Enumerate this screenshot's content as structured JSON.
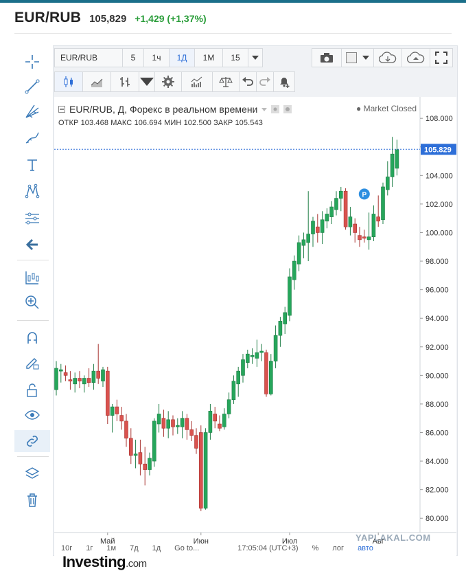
{
  "header": {
    "symbol": "EUR/RUB",
    "price": "105,829",
    "change": "+1,429 (+1,37%)"
  },
  "toolbar": {
    "symbol_input": "EUR/RUB",
    "intervals": [
      "5",
      "1ч",
      "1Д",
      "1М",
      "15"
    ],
    "selected_interval": "1Д"
  },
  "chart_header": {
    "title": "EUR/RUB, Д, Форекс в реальном времени",
    "status": "● Market Closed",
    "ohlc": "ОТКР 103.468  МАКС 106.694  МИН 102.500  ЗАКР 105.543"
  },
  "bottom": {
    "ranges": [
      "10г",
      "1г",
      "1м",
      "7д",
      "1д"
    ],
    "goto": "Go to...",
    "time": "17:05:04 (UTC+3)",
    "pct": "%",
    "log": "лог",
    "auto": "авто"
  },
  "watermark": "YAPLAKAL.COM",
  "logo": {
    "main": "Investing",
    "suffix": ".com"
  },
  "colors": {
    "up": "#26a65b",
    "down": "#d9534f",
    "last_price": "#2e6fd8",
    "marker": "#2e8fe0"
  },
  "chart_data": {
    "type": "candlestick",
    "title": "EUR/RUB, Д, Форекс в реальном времени",
    "ylim": [
      79.0,
      109.5
    ],
    "y_ticks": [
      80.0,
      82.0,
      84.0,
      86.0,
      88.0,
      90.0,
      92.0,
      94.0,
      96.0,
      98.0,
      100.0,
      102.0,
      104.0,
      106.0,
      108.0
    ],
    "x_labels": [
      "Май",
      "Июн",
      "Июл",
      "Авг"
    ],
    "x_label_index": [
      11,
      31,
      50,
      69
    ],
    "last_price": 105.829,
    "last_price_label": "105.829",
    "marker_label": "P",
    "marker": {
      "index": 66,
      "value": 102.7
    },
    "candles": [
      {
        "o": 89.0,
        "h": 91.0,
        "l": 88.6,
        "c": 90.5
      },
      {
        "o": 90.3,
        "h": 90.8,
        "l": 89.5,
        "c": 90.4
      },
      {
        "o": 90.2,
        "h": 90.7,
        "l": 89.6,
        "c": 90.0
      },
      {
        "o": 89.7,
        "h": 90.3,
        "l": 89.0,
        "c": 89.6
      },
      {
        "o": 89.4,
        "h": 90.2,
        "l": 88.8,
        "c": 89.8
      },
      {
        "o": 89.8,
        "h": 90.3,
        "l": 89.1,
        "c": 89.6
      },
      {
        "o": 89.4,
        "h": 90.0,
        "l": 88.8,
        "c": 89.8
      },
      {
        "o": 89.8,
        "h": 90.5,
        "l": 89.2,
        "c": 89.5
      },
      {
        "o": 89.5,
        "h": 90.8,
        "l": 89.0,
        "c": 90.3
      },
      {
        "o": 90.3,
        "h": 92.2,
        "l": 89.4,
        "c": 89.8
      },
      {
        "o": 89.6,
        "h": 90.6,
        "l": 89.2,
        "c": 90.4
      },
      {
        "o": 90.3,
        "h": 90.6,
        "l": 86.6,
        "c": 87.2
      },
      {
        "o": 87.2,
        "h": 88.0,
        "l": 86.0,
        "c": 87.8
      },
      {
        "o": 87.8,
        "h": 88.3,
        "l": 86.8,
        "c": 87.3
      },
      {
        "o": 87.2,
        "h": 87.8,
        "l": 86.2,
        "c": 86.8
      },
      {
        "o": 86.8,
        "h": 87.3,
        "l": 85.0,
        "c": 85.6
      },
      {
        "o": 85.6,
        "h": 86.3,
        "l": 83.8,
        "c": 84.4
      },
      {
        "o": 84.4,
        "h": 85.5,
        "l": 83.5,
        "c": 84.5
      },
      {
        "o": 84.6,
        "h": 85.5,
        "l": 83.0,
        "c": 83.8
      },
      {
        "o": 83.8,
        "h": 85.0,
        "l": 82.3,
        "c": 83.4
      },
      {
        "o": 83.4,
        "h": 84.6,
        "l": 83.0,
        "c": 84.2
      },
      {
        "o": 84.0,
        "h": 87.0,
        "l": 83.6,
        "c": 86.8
      },
      {
        "o": 86.6,
        "h": 88.0,
        "l": 86.0,
        "c": 87.3
      },
      {
        "o": 87.0,
        "h": 87.6,
        "l": 85.7,
        "c": 86.3
      },
      {
        "o": 86.3,
        "h": 87.5,
        "l": 85.6,
        "c": 86.9
      },
      {
        "o": 86.9,
        "h": 87.2,
        "l": 85.8,
        "c": 86.4
      },
      {
        "o": 86.4,
        "h": 87.0,
        "l": 85.9,
        "c": 86.5
      },
      {
        "o": 86.4,
        "h": 87.5,
        "l": 85.6,
        "c": 87.0
      },
      {
        "o": 87.0,
        "h": 87.3,
        "l": 85.5,
        "c": 86.2
      },
      {
        "o": 86.2,
        "h": 86.8,
        "l": 85.4,
        "c": 85.8
      },
      {
        "o": 85.8,
        "h": 86.3,
        "l": 84.5,
        "c": 84.9
      },
      {
        "o": 86.0,
        "h": 86.5,
        "l": 80.5,
        "c": 80.7
      },
      {
        "o": 80.7,
        "h": 86.3,
        "l": 80.6,
        "c": 86.0
      },
      {
        "o": 86.0,
        "h": 88.0,
        "l": 85.5,
        "c": 87.5
      },
      {
        "o": 87.3,
        "h": 87.8,
        "l": 86.3,
        "c": 86.8
      },
      {
        "o": 86.6,
        "h": 87.2,
        "l": 86.1,
        "c": 86.3
      },
      {
        "o": 86.4,
        "h": 87.7,
        "l": 86.2,
        "c": 87.3
      },
      {
        "o": 87.3,
        "h": 88.8,
        "l": 87.0,
        "c": 88.3
      },
      {
        "o": 88.3,
        "h": 90.0,
        "l": 88.0,
        "c": 89.6
      },
      {
        "o": 89.4,
        "h": 90.6,
        "l": 88.5,
        "c": 90.3
      },
      {
        "o": 90.0,
        "h": 91.5,
        "l": 89.5,
        "c": 91.1
      },
      {
        "o": 90.9,
        "h": 91.8,
        "l": 90.5,
        "c": 91.5
      },
      {
        "o": 91.3,
        "h": 91.9,
        "l": 90.8,
        "c": 91.4
      },
      {
        "o": 91.2,
        "h": 92.5,
        "l": 90.6,
        "c": 91.6
      },
      {
        "o": 91.6,
        "h": 92.2,
        "l": 91.0,
        "c": 91.7
      },
      {
        "o": 91.6,
        "h": 91.8,
        "l": 88.5,
        "c": 88.7
      },
      {
        "o": 88.7,
        "h": 91.5,
        "l": 88.6,
        "c": 91.0
      },
      {
        "o": 91.0,
        "h": 93.5,
        "l": 90.5,
        "c": 92.8
      },
      {
        "o": 92.8,
        "h": 94.1,
        "l": 92.0,
        "c": 93.8
      },
      {
        "o": 93.6,
        "h": 94.8,
        "l": 92.9,
        "c": 94.4
      },
      {
        "o": 94.2,
        "h": 97.5,
        "l": 93.8,
        "c": 96.9
      },
      {
        "o": 96.7,
        "h": 98.4,
        "l": 96.0,
        "c": 98.0
      },
      {
        "o": 97.8,
        "h": 99.8,
        "l": 97.3,
        "c": 99.3
      },
      {
        "o": 99.1,
        "h": 100.0,
        "l": 98.2,
        "c": 99.5
      },
      {
        "o": 99.3,
        "h": 102.9,
        "l": 98.0,
        "c": 99.9
      },
      {
        "o": 99.9,
        "h": 101.1,
        "l": 99.0,
        "c": 100.8
      },
      {
        "o": 100.4,
        "h": 101.3,
        "l": 99.3,
        "c": 100.0
      },
      {
        "o": 100.0,
        "h": 101.5,
        "l": 99.2,
        "c": 100.9
      },
      {
        "o": 100.8,
        "h": 101.7,
        "l": 100.3,
        "c": 101.3
      },
      {
        "o": 101.1,
        "h": 102.2,
        "l": 100.6,
        "c": 101.8
      },
      {
        "o": 101.6,
        "h": 102.9,
        "l": 101.2,
        "c": 102.4
      },
      {
        "o": 102.4,
        "h": 103.2,
        "l": 101.5,
        "c": 102.9
      },
      {
        "o": 102.9,
        "h": 103.1,
        "l": 100.2,
        "c": 100.4
      },
      {
        "o": 100.4,
        "h": 101.8,
        "l": 99.8,
        "c": 101.1
      },
      {
        "o": 100.6,
        "h": 101.0,
        "l": 99.3,
        "c": 100.0
      },
      {
        "o": 99.8,
        "h": 100.4,
        "l": 99.0,
        "c": 99.5
      },
      {
        "o": 99.7,
        "h": 100.2,
        "l": 99.3,
        "c": 99.6
      },
      {
        "o": 99.5,
        "h": 101.4,
        "l": 98.8,
        "c": 99.7
      },
      {
        "o": 99.7,
        "h": 101.9,
        "l": 99.4,
        "c": 101.3
      },
      {
        "o": 101.1,
        "h": 102.6,
        "l": 100.4,
        "c": 100.8
      },
      {
        "o": 100.9,
        "h": 103.5,
        "l": 100.6,
        "c": 103.2
      },
      {
        "o": 103.0,
        "h": 105.0,
        "l": 102.6,
        "c": 103.9
      },
      {
        "o": 103.9,
        "h": 106.7,
        "l": 103.2,
        "c": 105.5
      },
      {
        "o": 104.5,
        "h": 106.5,
        "l": 104.0,
        "c": 105.8
      }
    ]
  }
}
